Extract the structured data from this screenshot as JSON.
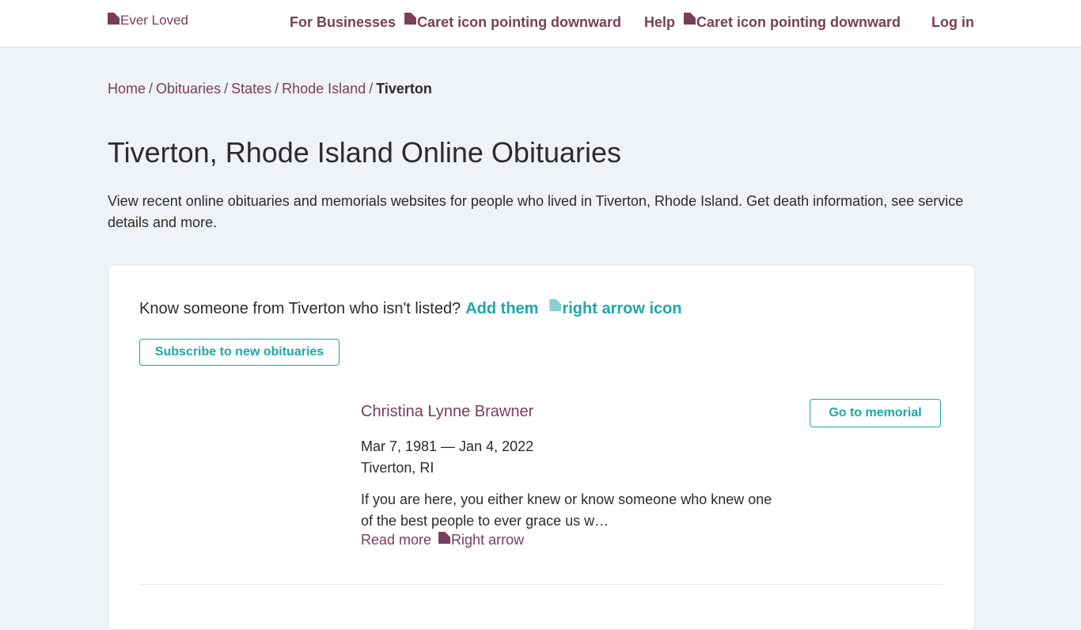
{
  "header": {
    "logo_alt": "Ever Loved",
    "nav": {
      "for_businesses": "For Businesses",
      "for_businesses_caret_alt": "Caret icon pointing downward",
      "help": "Help",
      "help_caret_alt": "Caret icon pointing downward",
      "login": "Log in"
    }
  },
  "breadcrumb": {
    "items": [
      "Home",
      "Obituaries",
      "States",
      "Rhode Island"
    ],
    "separator": "/",
    "current": "Tiverton"
  },
  "page": {
    "title": "Tiverton, Rhode Island Online Obituaries",
    "intro": "View recent online obituaries and memorials websites for people who lived in Tiverton, Rhode Island. Get death information, see service details and more."
  },
  "card": {
    "prompt": "Know someone from Tiverton who isn't listed?",
    "add_link": "Add them",
    "add_arrow_alt": "right arrow icon",
    "subscribe_label": "Subscribe to new obituaries",
    "entries": [
      {
        "name": "Christina Lynne Brawner",
        "dates": "Mar 7, 1981 — Jan 4, 2022",
        "location": "Tiverton, RI",
        "snippet": "If you are here, you either knew or know someone who knew one of the best people to ever grace us w…",
        "read_more": "Read more",
        "read_more_arrow_alt": "Right arrow",
        "go_label": "Go to memorial"
      }
    ]
  },
  "colors": {
    "brand": "#7a3e58",
    "accent": "#1fa7a8",
    "background": "#eff3f5"
  }
}
